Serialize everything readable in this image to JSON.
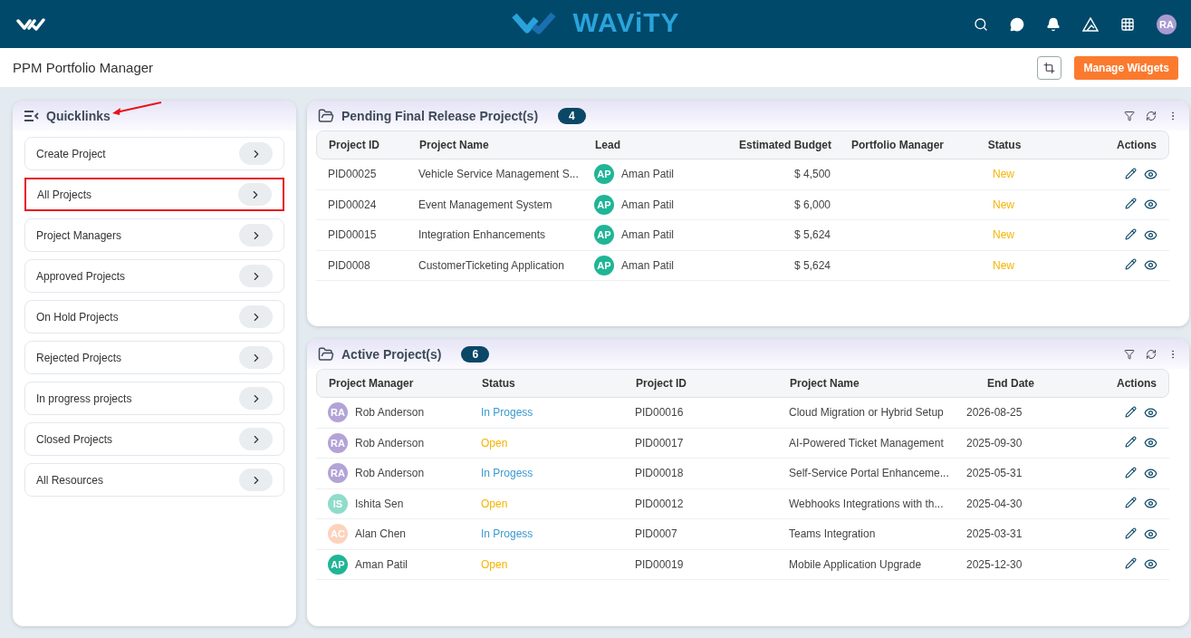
{
  "topbar": {
    "brand": "WAViTY",
    "avatar": "RA"
  },
  "page": {
    "title": "PPM Portfolio Manager",
    "button": "Manage Widgets"
  },
  "quicklinks": {
    "title": "Quicklinks",
    "arrow": true,
    "items": [
      {
        "label": "Create Project",
        "highlighted": false
      },
      {
        "label": "All Projects",
        "highlighted": true
      },
      {
        "label": "Project Managers",
        "highlighted": false
      },
      {
        "label": "Approved Projects",
        "highlighted": false
      },
      {
        "label": "On Hold Projects",
        "highlighted": false
      },
      {
        "label": "Rejected Projects",
        "highlighted": false
      },
      {
        "label": "In progress projects",
        "highlighted": false
      },
      {
        "label": "Closed Projects",
        "highlighted": false
      },
      {
        "label": "All Resources",
        "highlighted": false
      }
    ]
  },
  "pending": {
    "title": "Pending Final Release Project(s)",
    "count": "4",
    "columns": [
      "Project ID",
      "Project Name",
      "Lead",
      "Estimated Budget",
      "Portfolio Manager",
      "Status",
      "Actions"
    ],
    "rows": [
      {
        "id": "PID00025",
        "name": "Vehicle Service Management S...",
        "lead": {
          "initials": "AP",
          "name": "Aman Patil",
          "color": "#1fb596"
        },
        "budget": "$ 4,500",
        "status": "New"
      },
      {
        "id": "PID00024",
        "name": "Event Management System",
        "lead": {
          "initials": "AP",
          "name": "Aman Patil",
          "color": "#1fb596"
        },
        "budget": "$ 6,000",
        "status": "New"
      },
      {
        "id": "PID00015",
        "name": "Integration Enhancements",
        "lead": {
          "initials": "AP",
          "name": "Aman Patil",
          "color": "#1fb596"
        },
        "budget": "$ 5,624",
        "status": "New"
      },
      {
        "id": "PID0008",
        "name": "CustomerTicketing Application",
        "lead": {
          "initials": "AP",
          "name": "Aman Patil",
          "color": "#1fb596"
        },
        "budget": "$ 5,624",
        "status": "New"
      }
    ]
  },
  "active": {
    "title": "Active Project(s)",
    "count": "6",
    "columns": [
      "Project Manager",
      "Status",
      "Project ID",
      "Project Name",
      "End Date",
      "Actions"
    ],
    "rows": [
      {
        "manager": {
          "initials": "RA",
          "name": "Rob Anderson",
          "color": "#b3a3d6"
        },
        "status": {
          "text": "In Progess",
          "color": "#3b9ad1"
        },
        "id": "PID00016",
        "name": "Cloud Migration or Hybrid Setup",
        "end": "2026-08-25"
      },
      {
        "manager": {
          "initials": "RA",
          "name": "Rob Anderson",
          "color": "#b3a3d6"
        },
        "status": {
          "text": "Open",
          "color": "#f5b400"
        },
        "id": "PID00017",
        "name": "AI-Powered Ticket Management",
        "end": "2025-09-30"
      },
      {
        "manager": {
          "initials": "RA",
          "name": "Rob Anderson",
          "color": "#b3a3d6"
        },
        "status": {
          "text": "In Progess",
          "color": "#3b9ad1"
        },
        "id": "PID00018",
        "name": "Self-Service Portal Enhanceme...",
        "end": "2025-05-31"
      },
      {
        "manager": {
          "initials": "IS",
          "name": "Ishita Sen",
          "color": "#8fdccb"
        },
        "status": {
          "text": "Open",
          "color": "#f5b400"
        },
        "id": "PID00012",
        "name": "Webhooks Integrations with th...",
        "end": "2025-04-30"
      },
      {
        "manager": {
          "initials": "AC",
          "name": "Alan Chen",
          "color": "#fcd3bd"
        },
        "status": {
          "text": "In Progess",
          "color": "#3b9ad1"
        },
        "id": "PID0007",
        "name": "Teams Integration",
        "end": "2025-03-31"
      },
      {
        "manager": {
          "initials": "AP",
          "name": "Aman Patil",
          "color": "#1fb596"
        },
        "status": {
          "text": "Open",
          "color": "#f5b400"
        },
        "id": "PID00019",
        "name": "Mobile Application Upgrade",
        "end": "2025-12-30"
      }
    ]
  }
}
